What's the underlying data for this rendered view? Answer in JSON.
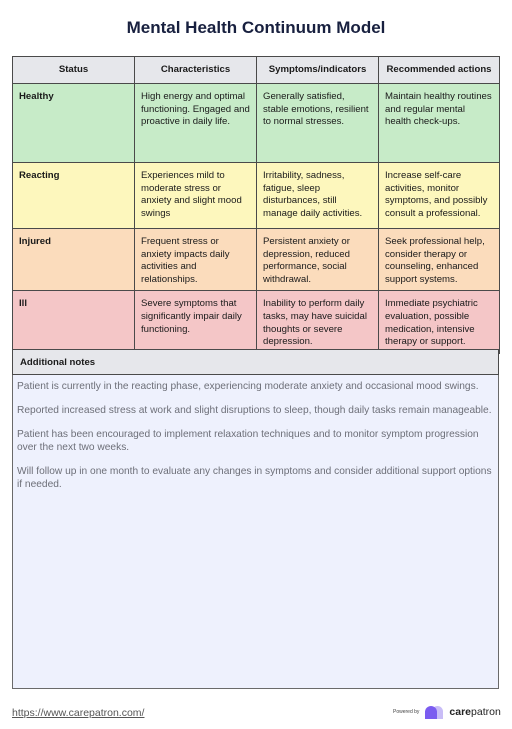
{
  "title": "Mental Health Continuum Model",
  "table": {
    "headers": [
      "Status",
      "Characteristics",
      "Symptoms/indicators",
      "Recommended actions"
    ],
    "rows": [
      {
        "status": "Healthy",
        "characteristics": "High energy and optimal functioning. Engaged and proactive in daily life.",
        "symptoms": "Generally satisfied, stable emotions, resilient to normal stresses.",
        "actions": "Maintain healthy routines and regular mental health check-ups.",
        "color": "#c7ebc8"
      },
      {
        "status": "Reacting",
        "characteristics": "Experiences mild to moderate stress or anxiety and slight mood swings",
        "symptoms": "Irritability, sadness, fatigue, sleep disturbances, still manage daily activities.",
        "actions": "Increase self-care activities, monitor symptoms, and possibly consult a professional.",
        "color": "#fdf7bd"
      },
      {
        "status": "Injured",
        "characteristics": "Frequent stress or anxiety impacts daily activities and relationships.",
        "symptoms": "Persistent anxiety or depression, reduced performance, social withdrawal.",
        "actions": "Seek professional help, consider therapy or counseling, enhanced support systems.",
        "color": "#fbdcbc"
      },
      {
        "status": "Ill",
        "characteristics": "Severe symptoms that significantly impair daily functioning.",
        "symptoms": "Inability to perform daily tasks, may have suicidal thoughts or severe depression.",
        "actions": "Immediate psychiatric evaluation, possible medication, intensive therapy or support.",
        "color": "#f4c6c7"
      }
    ]
  },
  "notes": {
    "header": "Additional notes",
    "paragraphs": [
      "Patient is currently in the reacting phase, experiencing moderate anxiety and occasional mood swings.",
      "Reported increased stress at work and slight disruptions to sleep, though daily tasks remain manageable.",
      "Patient has been encouraged to implement relaxation techniques and to monitor symptom progression over the next two weeks.",
      "Will follow up in one month to evaluate any changes in symptoms and consider additional support options if needed."
    ]
  },
  "footer": {
    "link": "https://www.carepatron.com/",
    "powered_by": "Powered by",
    "brand_bold": "care",
    "brand_rest": "patron",
    "logo_icon": "carepatron-logo-icon"
  }
}
